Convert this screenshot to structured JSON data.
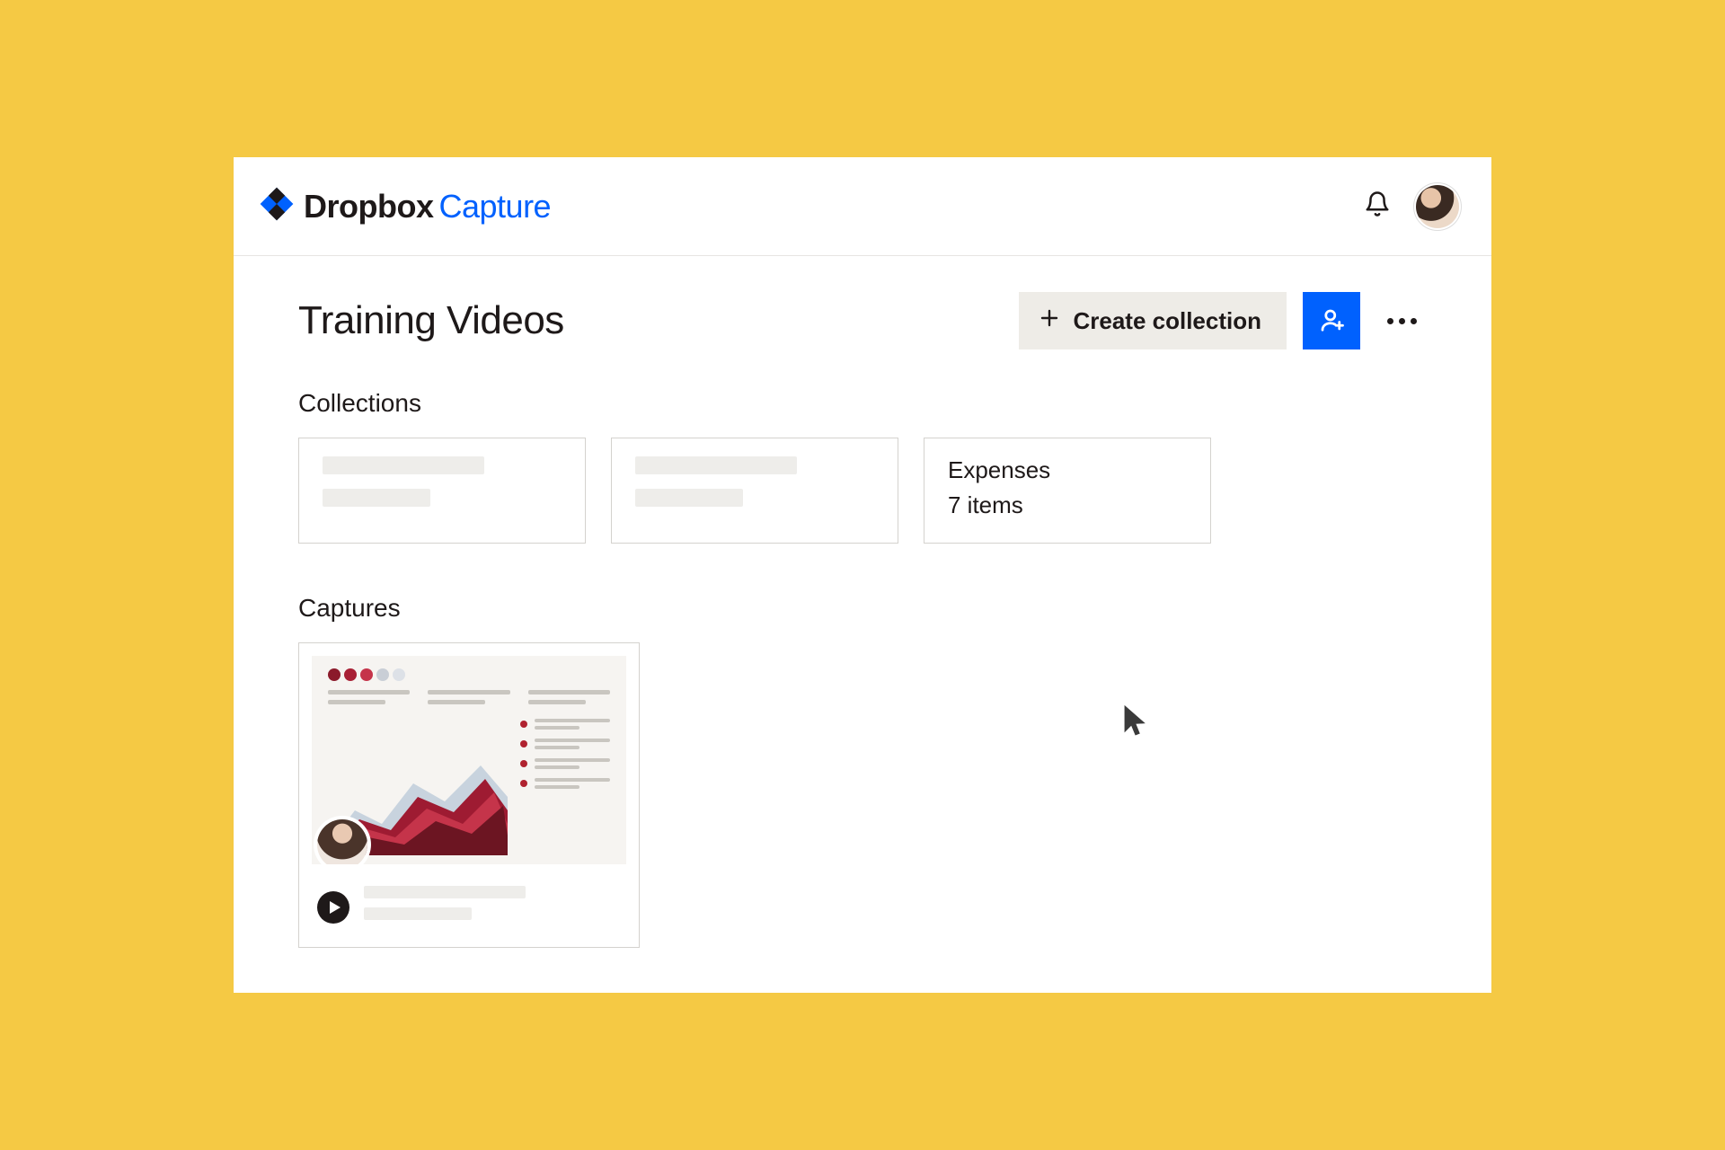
{
  "brand": {
    "name": "Dropbox",
    "product": "Capture"
  },
  "header": {
    "bell_icon": "bell-icon",
    "avatar": "avatar"
  },
  "page": {
    "title": "Training Videos"
  },
  "actions": {
    "create_label": "Create collection",
    "share_icon": "person-add-icon",
    "more_icon": "more-horizontal-icon"
  },
  "sections": {
    "collections_label": "Collections",
    "captures_label": "Captures"
  },
  "collections": [
    {
      "title": "",
      "subtitle": "",
      "placeholder": true
    },
    {
      "title": "",
      "subtitle": "",
      "placeholder": true
    },
    {
      "title": "Expenses",
      "subtitle": "7 items",
      "placeholder": false
    }
  ],
  "captures": [
    {
      "type": "video",
      "has_presenter": true
    }
  ],
  "colors": {
    "accent": "#0061FE",
    "bg": "#F5C944"
  }
}
